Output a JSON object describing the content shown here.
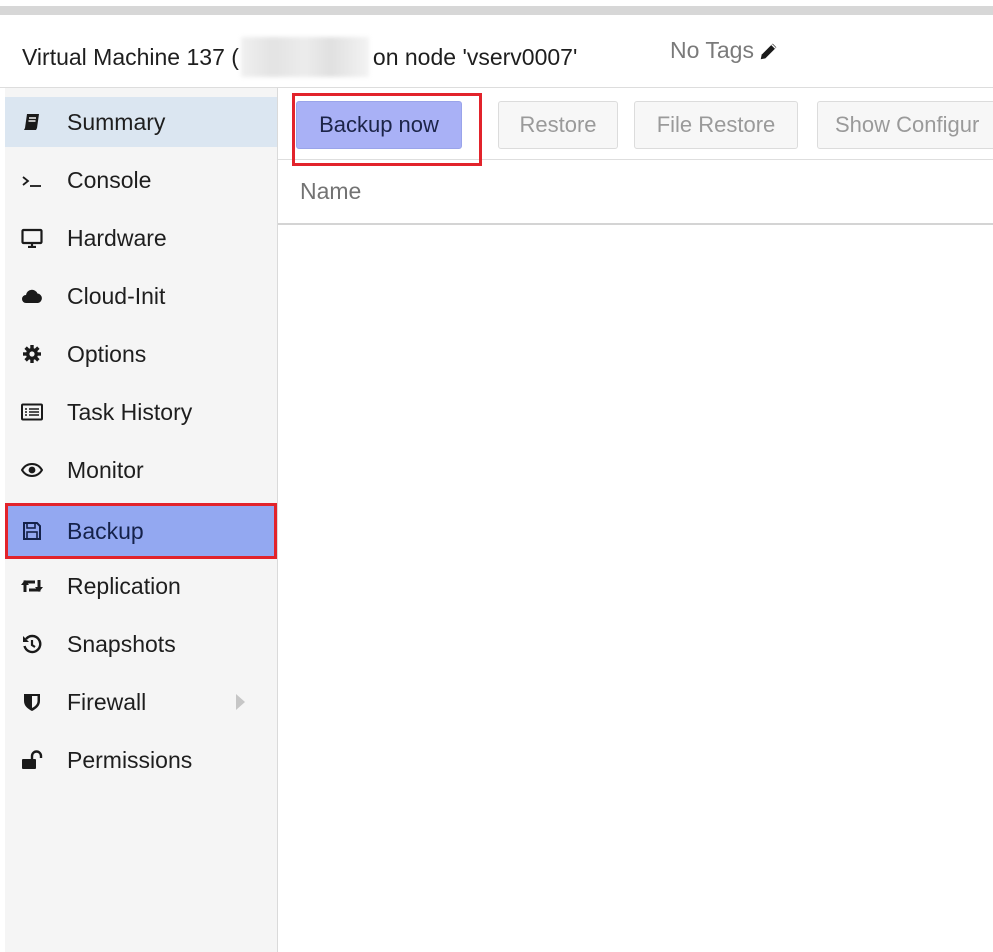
{
  "header": {
    "title_prefix": "Virtual Machine 137 (",
    "title_suffix": "on node 'vserv0007'",
    "tags": "No Tags"
  },
  "sidebar": {
    "items": [
      {
        "label": "Summary",
        "icon": "book-icon"
      },
      {
        "label": "Console",
        "icon": "terminal-icon"
      },
      {
        "label": "Hardware",
        "icon": "monitor-icon"
      },
      {
        "label": "Cloud-Init",
        "icon": "cloud-icon"
      },
      {
        "label": "Options",
        "icon": "gear-icon"
      },
      {
        "label": "Task History",
        "icon": "list-icon"
      },
      {
        "label": "Monitor",
        "icon": "eye-icon"
      },
      {
        "label": "Backup",
        "icon": "floppy-icon"
      },
      {
        "label": "Replication",
        "icon": "retweet-icon"
      },
      {
        "label": "Snapshots",
        "icon": "history-icon"
      },
      {
        "label": "Firewall",
        "icon": "shield-icon"
      },
      {
        "label": "Permissions",
        "icon": "unlock-icon"
      }
    ],
    "active": "Backup"
  },
  "toolbar": {
    "backup_now": "Backup now",
    "restore": "Restore",
    "file_restore": "File Restore",
    "show_configuration": "Show Configur"
  },
  "grid": {
    "columns": [
      "Name"
    ]
  },
  "colors": {
    "highlight_red": "#e2232b",
    "active_blue": "#93a8f1",
    "button_blue": "#a9b1f6"
  }
}
